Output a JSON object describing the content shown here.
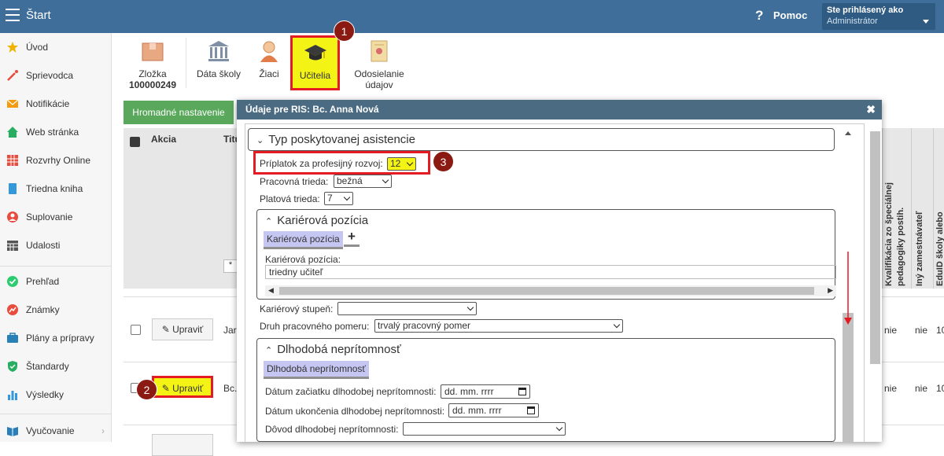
{
  "topbar": {
    "title": "Štart",
    "help_label": "Pomoc",
    "user_line1": "Ste prihlásený ako",
    "user_line2": "Administrátor"
  },
  "sidebar": {
    "items": [
      {
        "label": "Úvod",
        "icon": "star-icon",
        "color": "#f0b400"
      },
      {
        "label": "Sprievodca",
        "icon": "magic-wand-icon",
        "color": "#e74c3c"
      },
      {
        "label": "Notifikácie",
        "icon": "envelope-icon",
        "color": "#f39c12"
      },
      {
        "label": "Web stránka",
        "icon": "home-icon",
        "color": "#27ae60"
      },
      {
        "label": "Rozvrhy Online",
        "icon": "grid-icon",
        "color": "#e74c3c"
      },
      {
        "label": "Triedna kniha",
        "icon": "book-icon",
        "color": "#3498db"
      },
      {
        "label": "Suplovanie",
        "icon": "person-icon",
        "color": "#e74c3c"
      },
      {
        "label": "Udalosti",
        "icon": "calendar-icon",
        "color": "#555555"
      },
      {
        "label": "Prehľad",
        "icon": "check-circle-icon",
        "color": "#2ecc71"
      },
      {
        "label": "Známky",
        "icon": "chart-icon",
        "color": "#e74c3c"
      },
      {
        "label": "Plány a prípravy",
        "icon": "briefcase-icon",
        "color": "#2980b9"
      },
      {
        "label": "Štandardy",
        "icon": "shield-icon",
        "color": "#27ae60"
      },
      {
        "label": "Výsledky",
        "icon": "bar-chart-icon",
        "color": "#3498db"
      },
      {
        "label": "Vyučovanie",
        "icon": "book-open-icon",
        "color": "#2980b9"
      }
    ]
  },
  "toolbar": {
    "zlozka_label": "Zložka",
    "zlozka_number": "100000249",
    "data_skoly": "Dáta školy",
    "ziaci": "Žiaci",
    "ucitelia": "Učitelia",
    "odosielanie_1": "Odosielanie",
    "odosielanie_2": "údajov"
  },
  "main": {
    "mass_button": "Hromadné nastavenie",
    "col_akcia": "Akcia",
    "col_titul": "Titu",
    "filter_star": "*",
    "col_kvalif": "Kvalifikácia zo špeciálnej pedagogiky postih.",
    "col_iny": "Iný zamestnávateľ",
    "col_eduid": "EduID školy alebo",
    "rows": [
      {
        "edit": "Upraviť",
        "name": "Jar",
        "c1": "nie",
        "c2": "nie",
        "c3": "10"
      },
      {
        "edit": "Upraviť",
        "name": "Bc.",
        "c1": "nie",
        "c2": "nie",
        "c3": "10"
      }
    ]
  },
  "modal": {
    "title": "Údaje pre RIS: Bc. Anna Nová",
    "section_asistencie": "Typ poskytovanej asistencie",
    "priplatok_label": "Príplatok za profesijný rozvoj:",
    "priplatok_value": "12",
    "pracovna_label": "Pracovná trieda:",
    "pracovna_value": "bežná",
    "platova_label": "Platová trieda:",
    "platova_value": "7",
    "kariera_title": "Kariérová pozícia",
    "kariera_tab": "Kariérová pozícia",
    "kariera_add": "+",
    "kariera_field_label": "Kariérová pozícia:",
    "kariera_field_value": "triedny učiteľ",
    "stupen_label": "Kariérový stupeň:",
    "stupen_value": "",
    "druh_label": "Druh pracovného pomeru:",
    "druh_value": "trvalý pracovný pomer",
    "dlhodoba_title": "Dlhodobá neprítomnosť",
    "dlhodoba_tab": "Dlhodobá neprítomnosť",
    "zaciatok_label": "Dátum začiatku dlhodobej neprítomnosti:",
    "zaciatok_value": "dd. mm. rrrr",
    "ukoncenie_label": "Dátum ukončenia dlhodobej neprítomnosti:",
    "ukoncenie_value": "dd. mm. rrrr",
    "dovod_label": "Dôvod dlhodobej neprítomnosti:",
    "dovod_value": ""
  },
  "callouts": {
    "one": "1",
    "two": "2",
    "three": "3"
  }
}
